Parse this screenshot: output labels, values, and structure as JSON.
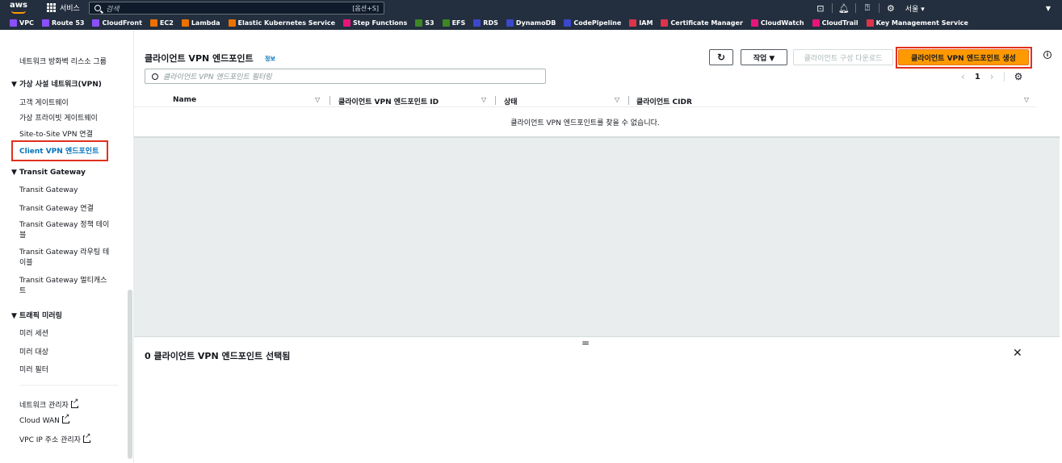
{
  "nav": {
    "logo": "aws",
    "services": "서비스",
    "search_placeholder": "검색",
    "search_shortcut": "[옵션+S]",
    "region": "서울 ▾",
    "favorites": [
      {
        "label": "VPC",
        "color": "#8c4fff"
      },
      {
        "label": "Route 53",
        "color": "#8c4fff"
      },
      {
        "label": "CloudFront",
        "color": "#8c4fff"
      },
      {
        "label": "EC2",
        "color": "#ed7100"
      },
      {
        "label": "Lambda",
        "color": "#ed7100"
      },
      {
        "label": "Elastic Kubernetes Service",
        "color": "#ed7100"
      },
      {
        "label": "Step Functions",
        "color": "#e7157b"
      },
      {
        "label": "S3",
        "color": "#3f8624"
      },
      {
        "label": "EFS",
        "color": "#3f8624"
      },
      {
        "label": "RDS",
        "color": "#3b48cc"
      },
      {
        "label": "DynamoDB",
        "color": "#3b48cc"
      },
      {
        "label": "CodePipeline",
        "color": "#3b48cc"
      },
      {
        "label": "IAM",
        "color": "#dd344c"
      },
      {
        "label": "Certificate Manager",
        "color": "#dd344c"
      },
      {
        "label": "CloudWatch",
        "color": "#e7157b"
      },
      {
        "label": "CloudTrail",
        "color": "#e7157b"
      },
      {
        "label": "Key Management Service",
        "color": "#dd344c"
      }
    ]
  },
  "sidebar": {
    "item_cut": "네트워크 방화벽 리스소 그룹",
    "section_vpn": "▼ 가상 사설 네트워크(VPN)",
    "customer_gateway": "고객 게이트웨이",
    "virtual_private_gateway": "가상 프라이빗 게이트웨이",
    "site_to_site": "Site-to-Site VPN 연결",
    "client_vpn": "Client VPN 엔드포인트",
    "section_tgw": "▼ Transit Gateway",
    "tgw": "Transit Gateway",
    "tgw_attach": "Transit Gateway 연결",
    "tgw_policy_1": "Transit Gateway 정책 테이",
    "tgw_policy_2": "블",
    "tgw_route_1": "Transit Gateway 라우팅 테",
    "tgw_route_2": "이블",
    "tgw_multicast_1": "Transit Gateway 멀티캐스",
    "tgw_multicast_2": "트",
    "section_mirror": "▼ 트래픽 미러링",
    "mirror_session": "미러 세션",
    "mirror_target": "미러 대상",
    "mirror_filter": "미러 필터",
    "network_manager": "네트워크 관리자",
    "cloud_wan": "Cloud WAN",
    "ipam": "VPC IP 주소 관리자"
  },
  "main": {
    "title": "클라이언트 VPN 엔드포인트",
    "info": "정보",
    "refresh": "↻",
    "actions": "작업 ▼",
    "download": "클라이언트 구성 다운로드",
    "create": "클라이언트 VPN 엔드포인트 생성",
    "filter_placeholder": "클라이언트 VPN 엔드포인트 필터링",
    "page": "1",
    "columns": [
      "Name",
      "클라이언트 VPN 엔드포인트 ID",
      "상태",
      "클라이언트 CIDR"
    ],
    "empty": "클라이언트 VPN 엔드포인트를 찾을 수 없습니다.",
    "panel_title": "0 클라이언트 VPN 엔드포인트 선택됨"
  }
}
